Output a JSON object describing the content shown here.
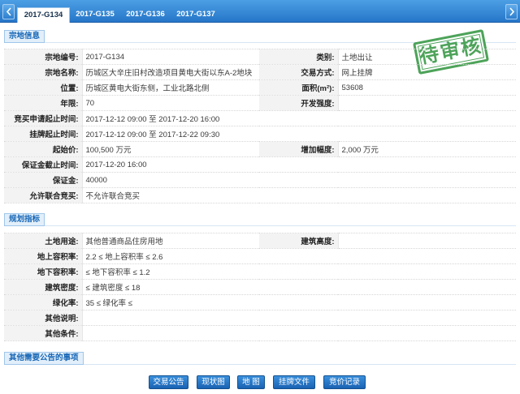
{
  "tabs": {
    "prev_icon": "chevron-left-icon",
    "next_icon": "chevron-right-icon",
    "items": [
      {
        "label": "2017-G134",
        "active": true
      },
      {
        "label": "2017-G135",
        "active": false
      },
      {
        "label": "2017-G136",
        "active": false
      },
      {
        "label": "2017-G137",
        "active": false
      }
    ]
  },
  "stamp": {
    "text": "待审核"
  },
  "land_info": {
    "title": "宗地信息",
    "rows": [
      {
        "label": "宗地编号:",
        "value": "2017-G134",
        "label2": "类别:",
        "value2": "土地出让"
      },
      {
        "label": "宗地名称:",
        "value": "历城区大辛庄旧村改造项目黄电大街以东A-2地块",
        "label2": "交易方式:",
        "value2": "网上挂牌"
      },
      {
        "label": "位置:",
        "value": "历城区黄电大街东侧，工业北路北侧",
        "label2": "面积(m²):",
        "value2": "53608"
      },
      {
        "label": "年限:",
        "value": "70",
        "label2": "开发强度:"
      },
      {
        "label": "竞买申请起止时间:",
        "value": "2017-12-12 09:00 至 2017-12-20 16:00"
      },
      {
        "label": "挂牌起止时间:",
        "value": "2017-12-12 09:00 至 2017-12-22 09:30"
      },
      {
        "label": "起始价:",
        "value": "100,500 万元",
        "label2": "增加幅度:",
        "value2": "2,000 万元"
      },
      {
        "label": "保证金截止时间:",
        "value": "2017-12-20 16:00"
      },
      {
        "label": "保证金:",
        "value": "40000"
      },
      {
        "label": "允许联合竞买:",
        "value": "不允许联合竞买"
      }
    ]
  },
  "planning": {
    "title": "规划指标",
    "rows": [
      {
        "label": "土地用途:",
        "value": "其他普通商品住房用地",
        "label2": "建筑高度:"
      },
      {
        "label": "地上容积率:",
        "value": "2.2 ≤ 地上容积率 ≤ 2.6"
      },
      {
        "label": "地下容积率:",
        "value": "≤ 地下容积率 ≤ 1.2"
      },
      {
        "label": "建筑密度:",
        "value": "≤ 建筑密度 ≤ 18"
      },
      {
        "label": "绿化率:",
        "value": "35 ≤ 绿化率 ≤"
      },
      {
        "label": "其他说明:"
      },
      {
        "label": "其他条件:"
      }
    ]
  },
  "other_notices": {
    "title": "其他需要公告的事项"
  },
  "actions": {
    "buttons": [
      {
        "label": "交易公告"
      },
      {
        "label": "现状图"
      },
      {
        "label": "地 图"
      },
      {
        "label": "挂牌文件"
      },
      {
        "label": "竞价记录"
      }
    ]
  },
  "colors": {
    "tab_bar": "#2f82d2",
    "accent": "#1565b5",
    "stamp": "#3a9a48",
    "button": "#1e6fc4",
    "label_bg": "#f3f3f3"
  }
}
